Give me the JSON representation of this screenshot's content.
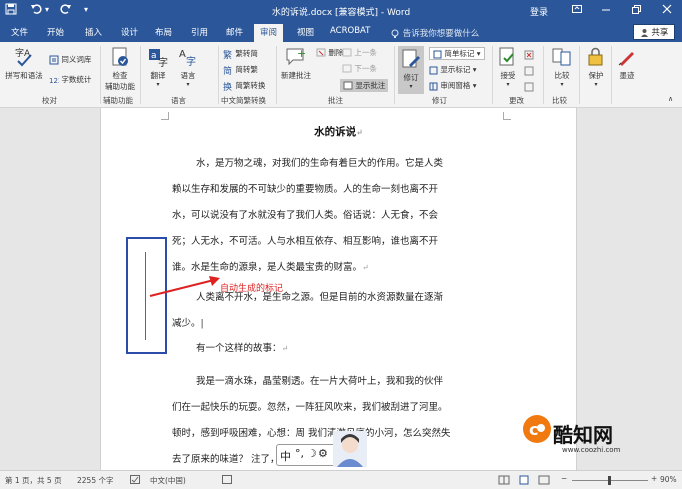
{
  "titlebar": {
    "title": "水的诉说.docx [兼容模式] - Word",
    "login": "登录"
  },
  "tabs": [
    "文件",
    "开始",
    "插入",
    "设计",
    "布局",
    "引用",
    "邮件",
    "审阅",
    "视图",
    "ACROBAT"
  ],
  "active_tab": "审阅",
  "tell_me": "告诉我你想要做什么",
  "share": "共享",
  "ribbon": {
    "proofing": {
      "spell": "拼写和语法",
      "thesaurus": "同义词库",
      "wordcount": "字数统计",
      "label": "校对"
    },
    "accessibility": {
      "check": "检查",
      "check2": "辅助功能",
      "label": "辅助功能"
    },
    "language": {
      "translate": "翻译",
      "language": "语言",
      "label": "语言"
    },
    "chinese": {
      "to_trad": "繁转简",
      "to_simp": "简转繁",
      "convert": "简繁转换",
      "label": "中文简繁转换"
    },
    "comments": {
      "new": "新建批注",
      "delete": "删除",
      "prev": "上一条",
      "next": "下一条",
      "show": "显示批注",
      "label": "批注"
    },
    "tracking": {
      "track": "修订",
      "simple": "简单标记",
      "show_markup": "显示标记",
      "pane": "审阅窗格",
      "label": "修订"
    },
    "changes": {
      "accept": "接受",
      "label": "更改"
    },
    "compare": {
      "compare": "比较",
      "label": "比较"
    },
    "protect": {
      "protect": "保护"
    },
    "ink": {
      "ink": "墨迹"
    }
  },
  "document": {
    "title": "水的诉说",
    "p1": [
      "水，是万物之魂，对我们的生命有着巨大的作用。它是人类",
      "赖以生存和发展的不可缺少的重要物质。人的生命一刻也离不开",
      "水，可以说没有了水就没有了我们人类。俗话说：人无食，不会",
      "死；人无水，不可活。人与水相互依存、相互影响，谁也离不开",
      "谁。水是生命的源泉，是人类最宝贵的财富。"
    ],
    "p2": [
      "人类离不开水，是生命之源。但是目前的水资源数量在逐渐",
      "减少。"
    ],
    "p3": "有一个这样的故事：",
    "p4": [
      "我是一滴水珠，晶莹剔透。在一片大荷叶上，我和我的伙伴",
      "们在一起快乐的玩耍。忽然，一阵狂风吹来，我们被刮进了河里。",
      "顿时，感到呼吸困难，心想：周     我们清澈见底的小河，怎么突然失",
      "去了原来的味道？     注了，河上飘着难闻的气"
    ]
  },
  "annotation": {
    "text": "自动生成的标记"
  },
  "ime": {
    "label": "中"
  },
  "watermark": {
    "name": "酷知网",
    "url": "www.coozhi.com"
  },
  "status": {
    "page": "第 1 页，共 5 页",
    "words": "2255 个字",
    "lang": "中文(中国)",
    "zoom": "90%"
  },
  "colors": {
    "word_blue": "#2b579a",
    "annotation_red": "#d22222",
    "box_blue": "#2b4ca8"
  }
}
